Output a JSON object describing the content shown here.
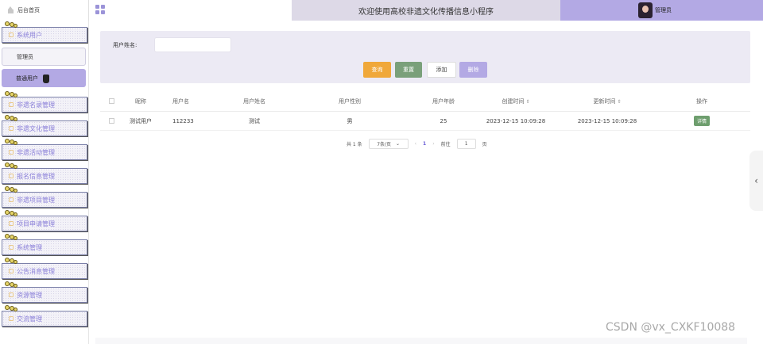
{
  "topbar": {
    "home_label": "后台首页",
    "title": "欢迎使用高校非遗文化传播信息小程序",
    "user_label": "管理员"
  },
  "sidebar": {
    "items": [
      {
        "label": "系统用户"
      },
      {
        "label": "非遗名录管理"
      },
      {
        "label": "非遗文化管理"
      },
      {
        "label": "非遗活动管理"
      },
      {
        "label": "报名信息管理"
      },
      {
        "label": "非遗项目管理"
      },
      {
        "label": "项目申请管理"
      },
      {
        "label": "系统管理"
      },
      {
        "label": "公告消息管理"
      },
      {
        "label": "资源管理"
      },
      {
        "label": "交流管理"
      }
    ],
    "sub_items": [
      {
        "label": "管理员"
      },
      {
        "label": "普通用户"
      }
    ]
  },
  "filter": {
    "label": "用户姓名:",
    "value": "",
    "buttons": {
      "search": "查询",
      "reset": "重置",
      "add": "添加",
      "delete": "删除"
    }
  },
  "table": {
    "headers": [
      "昵称",
      "用户名",
      "用户姓名",
      "用户性别",
      "用户年龄",
      "创建时间",
      "更新时间",
      "操作"
    ],
    "sort_glyph": "⇕",
    "rows": [
      {
        "nickname": "测试用户",
        "username": "112233",
        "name": "测试",
        "gender": "男",
        "age": "25",
        "created": "2023-12-15 10:09:28",
        "updated": "2023-12-15 10:09:28",
        "action": "详情"
      }
    ]
  },
  "pager": {
    "total": "共 1 条",
    "page_size": "7条/页",
    "prev": "‹",
    "current": "1",
    "next": "›",
    "goto_prefix": "前往",
    "goto_value": "1",
    "goto_suffix": "页"
  },
  "side_handle": "‹",
  "watermark": "CSDN @vx_CXKF10088"
}
